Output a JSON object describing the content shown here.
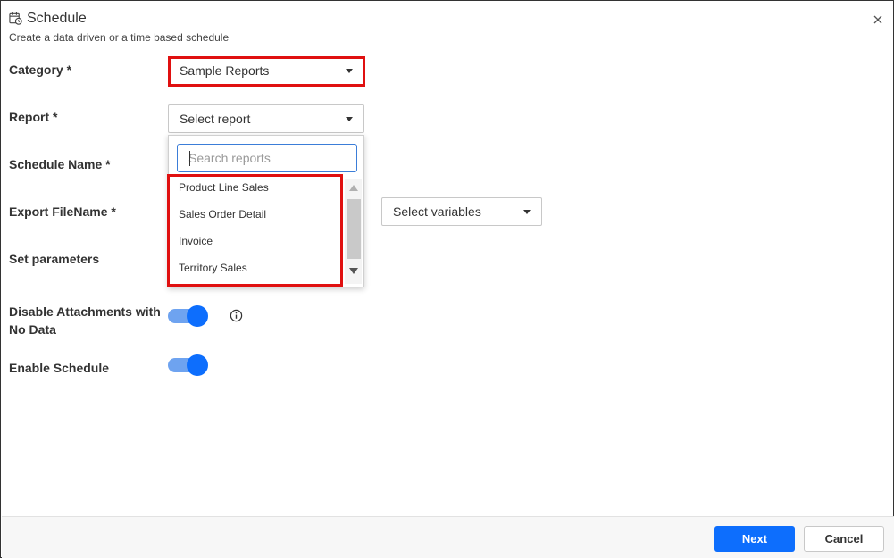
{
  "header": {
    "title": "Schedule",
    "subtitle": "Create a data driven or a time based schedule",
    "icon": "calendar-clock-icon"
  },
  "form": {
    "category_label": "Category *",
    "category_value": "Sample Reports",
    "report_label": "Report *",
    "report_value": "Select report",
    "schedule_name_label": "Schedule Name *",
    "export_filename_label": "Export FileName *",
    "variables_value": "Select variables",
    "set_parameters_label": "Set parameters",
    "disable_attachments_label_line1": "Disable Attachments with",
    "disable_attachments_label_line2": "No Data",
    "enable_schedule_label": "Enable Schedule"
  },
  "report_dropdown": {
    "search_placeholder": "Search reports",
    "options": [
      "Product Line Sales",
      "Sales Order Detail",
      "Invoice",
      "Territory Sales"
    ]
  },
  "toggles": {
    "disable_attachments": true,
    "enable_schedule": true
  },
  "footer": {
    "next_label": "Next",
    "cancel_label": "Cancel"
  },
  "colors": {
    "accent": "#0d6efd",
    "highlight": "#e01010"
  }
}
